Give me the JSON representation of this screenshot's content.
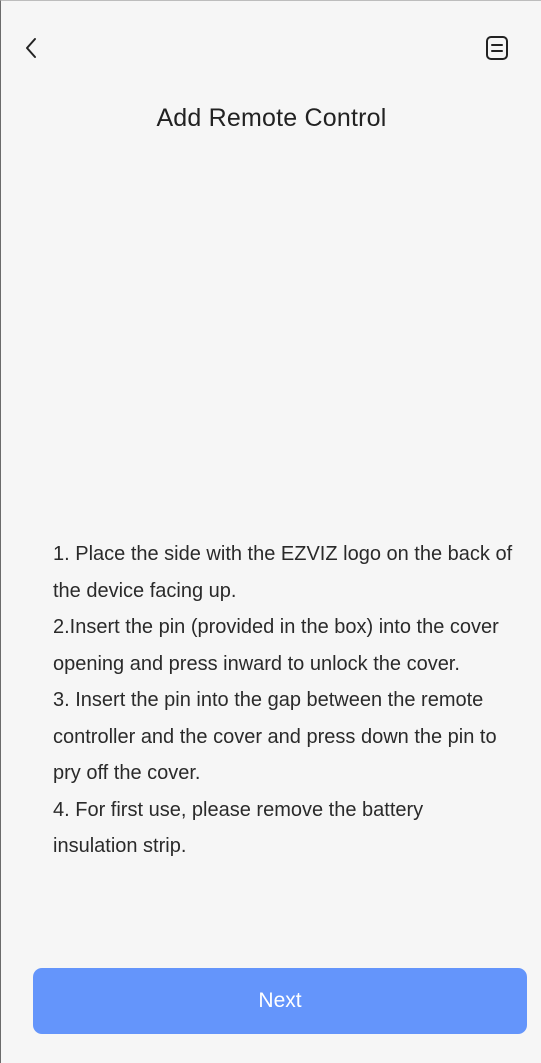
{
  "header": {
    "back_icon": "chevron-left-icon",
    "guide_icon": "document-icon",
    "title": "Add Remote Control"
  },
  "instructions": [
    "1. Place the side with the EZVIZ logo on the back of the device facing up.",
    "2.Insert the pin (provided in the box) into the cover opening and press inward to unlock the cover.",
    "3. Insert the pin into the gap between the remote controller and the cover and press down the pin to pry off the cover.",
    "4. For first use, please remove the battery insulation strip."
  ],
  "footer": {
    "next_label": "Next"
  },
  "colors": {
    "background": "#f6f6f6",
    "accent": "#6495fb",
    "text": "#2a2a2a"
  }
}
